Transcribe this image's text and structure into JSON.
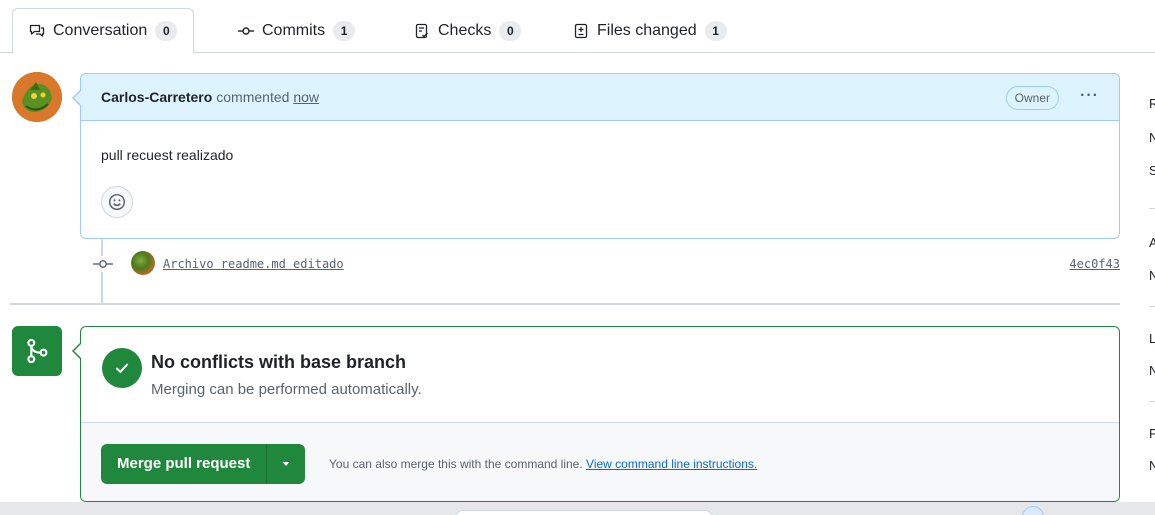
{
  "tabs": [
    {
      "label": "Conversation",
      "count": "0",
      "icon": "comment-discussion-icon"
    },
    {
      "label": "Commits",
      "count": "1",
      "icon": "git-commit-icon"
    },
    {
      "label": "Checks",
      "count": "0",
      "icon": "checklist-icon"
    },
    {
      "label": "Files changed",
      "count": "1",
      "icon": "file-diff-icon"
    }
  ],
  "comment": {
    "author": "Carlos-Carretero",
    "action": "commented",
    "time": "now",
    "badge": "Owner",
    "body": "pull recuest realizado",
    "menu_icon": "kebab-horizontal-icon",
    "reaction_icon": "smiley-icon"
  },
  "commit": {
    "message": "Archivo readme.md editado",
    "sha": "4ec0f43"
  },
  "merge": {
    "title": "No conflicts with base branch",
    "subtitle": "Merging can be performed automatically.",
    "button_label": "Merge pull request",
    "hint_text": "You can also merge this with the command line.",
    "hint_link": "View command line instructions.",
    "status_color": "#1f883d"
  },
  "sidebar_letters": [
    "R",
    "N",
    "S",
    "A",
    "N",
    "L",
    "N",
    "P",
    "N"
  ]
}
